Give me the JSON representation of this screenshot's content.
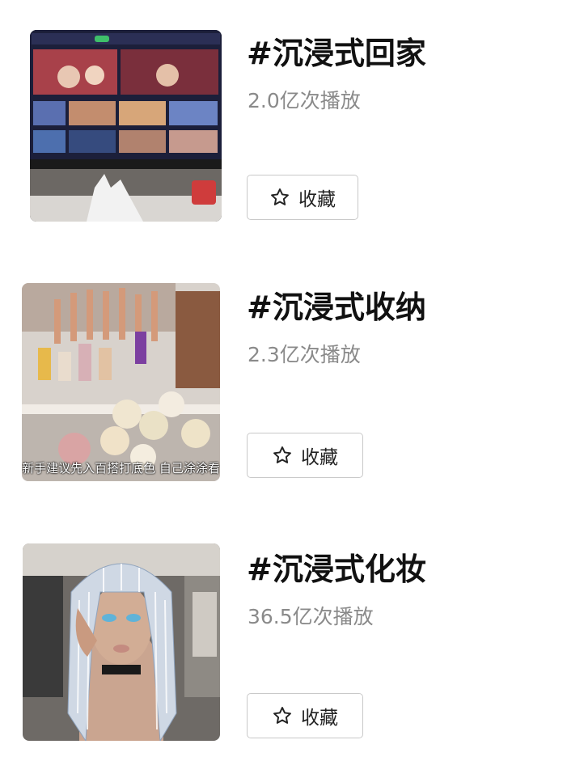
{
  "items": [
    {
      "title": "#沉浸式回家",
      "plays": "2.0亿次播放",
      "button_label": "收藏",
      "thumbnail": "living-room-tv",
      "subtitle": ""
    },
    {
      "title": "#沉浸式收纳",
      "plays": "2.3亿次播放",
      "button_label": "收藏",
      "thumbnail": "nail-polish-organizer",
      "subtitle": "新手建议先入百搭打底色 自己涂涂看"
    },
    {
      "title": "#沉浸式化妆",
      "plays": "36.5亿次播放",
      "button_label": "收藏",
      "thumbnail": "silver-wig-makeup",
      "subtitle": ""
    }
  ],
  "icons": {
    "favorite": "star-outline-icon"
  },
  "colors": {
    "title": "#111111",
    "plays": "#8a8a8a",
    "button_border": "#c9c9c9"
  }
}
